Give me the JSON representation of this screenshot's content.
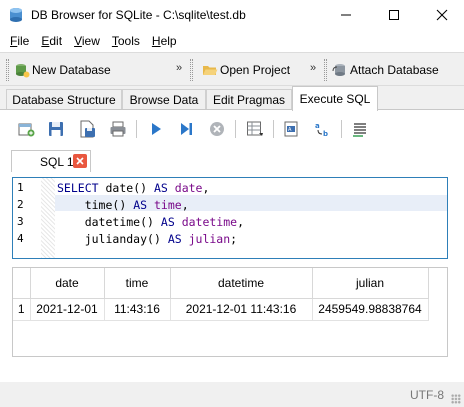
{
  "window": {
    "title": "DB Browser for SQLite - C:\\sqlite\\test.db"
  },
  "menu": [
    {
      "label": "File",
      "mnemonic": "F",
      "rest": "ile"
    },
    {
      "label": "Edit",
      "mnemonic": "E",
      "rest": "dit"
    },
    {
      "label": "View",
      "mnemonic": "V",
      "rest": "iew"
    },
    {
      "label": "Tools",
      "mnemonic": "T",
      "rest": "ools"
    },
    {
      "label": "Help",
      "mnemonic": "H",
      "rest": "elp"
    }
  ],
  "toolbar": {
    "new_database": "New Database",
    "open_project": "Open Project",
    "attach_database": "Attach Database",
    "more": "»"
  },
  "tabs": [
    "Database Structure",
    "Browse Data",
    "Edit Pragmas",
    "Execute SQL"
  ],
  "active_tab": "Execute SQL",
  "sql_tab": {
    "label": "SQL 1"
  },
  "editor": {
    "line_numbers": [
      "1",
      "2",
      "3",
      "4"
    ],
    "lines": [
      "SELECT date() AS date,",
      "    time() AS time,",
      "    datetime() AS datetime,",
      "    julianday() AS julian;"
    ]
  },
  "results": {
    "columns": [
      "date",
      "time",
      "datetime",
      "julian"
    ],
    "rows": [
      {
        "num": "1",
        "cells": [
          "2021-12-01",
          "11:43:16",
          "2021-12-01 11:43:16",
          "2459549.98838764"
        ]
      }
    ]
  },
  "status": {
    "encoding": "UTF-8"
  },
  "colors": {
    "accent": "#2e7fb8",
    "keyword": "#00008b",
    "identifier": "#7a0a8a",
    "close_tab": "#e9573f"
  }
}
